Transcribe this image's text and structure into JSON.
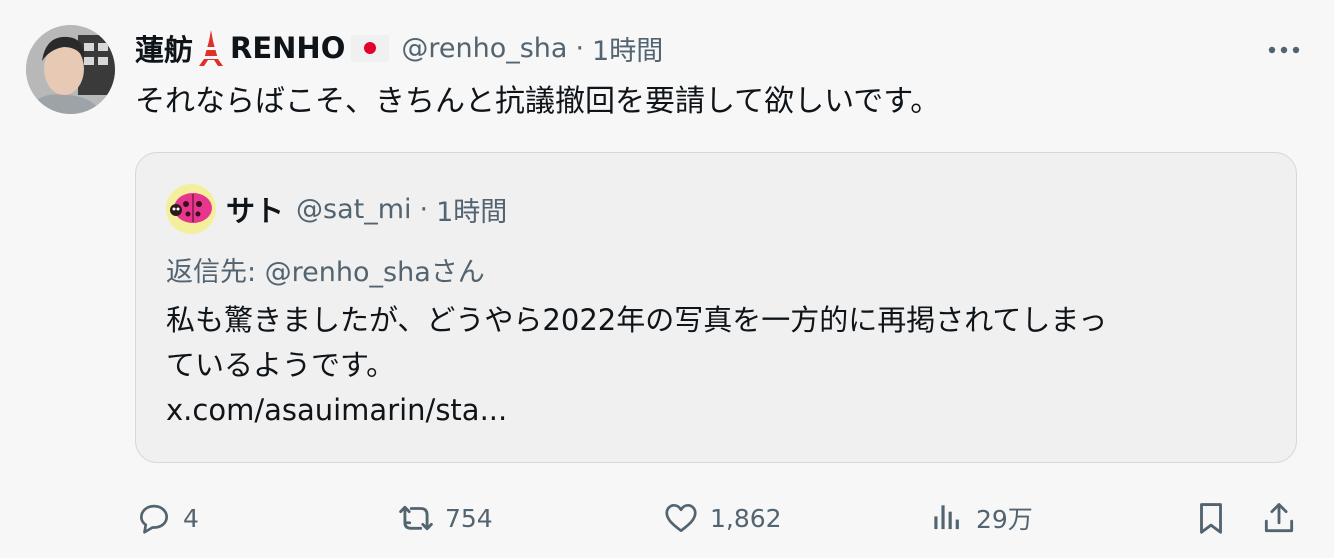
{
  "tweet": {
    "display_name": "蓮舫",
    "display_name_suffix": "RENHO",
    "handle": "@renho_sha",
    "separator": "·",
    "time": "1時間",
    "text": "それならばこそ、きちんと抗議撤回を要請して欲しいです。"
  },
  "quote": {
    "display_name": "サト",
    "handle": "@sat_mi",
    "separator": "·",
    "time": "1時間",
    "reply_to": "返信先: @renho_shaさん",
    "body_lines": [
      "私も驚きましたが、どうやら2022年の写真を一方的に再掲されてしまっ",
      "ているようです。",
      "x.com/asauimarin/sta..."
    ]
  },
  "actions": {
    "replies": "4",
    "retweets": "754",
    "likes": "1,862",
    "views": "29万"
  },
  "icons": {
    "avatar": "profile-photo",
    "tower": "tokyo-tower-icon",
    "flag": "japan-flag-icon",
    "more": "more-icon",
    "reply": "reply-icon",
    "retweet": "retweet-icon",
    "like": "heart-icon",
    "views": "views-chart-icon",
    "bookmark": "bookmark-icon",
    "share": "share-icon"
  },
  "colors": {
    "text": "#0f1419",
    "secondary": "#536471",
    "border": "#cfd9de",
    "flag_red": "#e4002b",
    "tower_red": "#e0302a"
  }
}
